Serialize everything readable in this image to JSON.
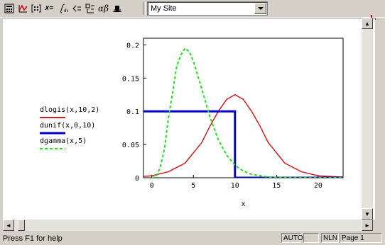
{
  "toolbar": {
    "icons": [
      "calculator-icon",
      "graph-icon",
      "matrix-icon",
      "evaluation-icon",
      "calculus-icon",
      "boolean-icon",
      "programming-icon",
      "greek-icon",
      "symbolic-icon"
    ],
    "eval_label": "x=",
    "resource_combo_value": "My Site"
  },
  "legend": {
    "entries": [
      {
        "label": "dlogis(x,10,2)",
        "color": "#cc2020",
        "style": "solid"
      },
      {
        "label": "dunif(x,0,10)",
        "color": "#0000cc",
        "style": "solid"
      },
      {
        "label": "dgamma(x,5)",
        "color": "#22dd22",
        "style": "dashed"
      }
    ]
  },
  "chart_data": {
    "type": "line",
    "xlabel": "x",
    "ylabel": "",
    "xlim": [
      -1,
      23
    ],
    "ylim": [
      0,
      0.21
    ],
    "xticks": [
      "0",
      "5",
      "10",
      "15",
      "20"
    ],
    "yticks": [
      "0",
      "0.05",
      "0.1",
      "0.15",
      "0.2"
    ],
    "series": [
      {
        "name": "dlogis(x,10,2)",
        "color": "#cc2020",
        "style": "solid",
        "x": [
          -1,
          0,
          2,
          4,
          6,
          7,
          8,
          9,
          10,
          11,
          12,
          13,
          14,
          16,
          18,
          20,
          23
        ],
        "y": [
          0.002,
          0.003,
          0.009,
          0.022,
          0.053,
          0.078,
          0.1,
          0.118,
          0.125,
          0.118,
          0.1,
          0.078,
          0.053,
          0.022,
          0.009,
          0.003,
          0.001
        ]
      },
      {
        "name": "dunif(x,0,10)",
        "color": "#0000cc",
        "style": "solid",
        "x": [
          -1,
          0,
          0,
          10,
          10,
          23
        ],
        "y": [
          0.1,
          0.1,
          0.1,
          0.1,
          0,
          0
        ]
      },
      {
        "name": "dgamma(x,5)",
        "color": "#22dd22",
        "style": "dashed",
        "x": [
          0,
          0.5,
          1,
          1.5,
          2,
          2.5,
          3,
          3.5,
          4,
          4.5,
          5,
          6,
          7,
          8,
          9,
          10,
          11,
          12,
          14,
          16,
          18,
          20,
          23
        ],
        "y": [
          0,
          0.0016,
          0.015,
          0.042,
          0.09,
          0.128,
          0.168,
          0.185,
          0.195,
          0.19,
          0.175,
          0.134,
          0.091,
          0.057,
          0.034,
          0.019,
          0.01,
          0.005,
          0.001,
          0.0003,
          0.0001,
          0,
          0
        ]
      }
    ]
  },
  "scroll": {
    "up": "▲",
    "down": "▼",
    "left": "◄",
    "right": "►"
  },
  "status": {
    "help": "Press F1 for help",
    "auto": "AUTO",
    "nlm": "NLN",
    "page": "Page 1"
  }
}
